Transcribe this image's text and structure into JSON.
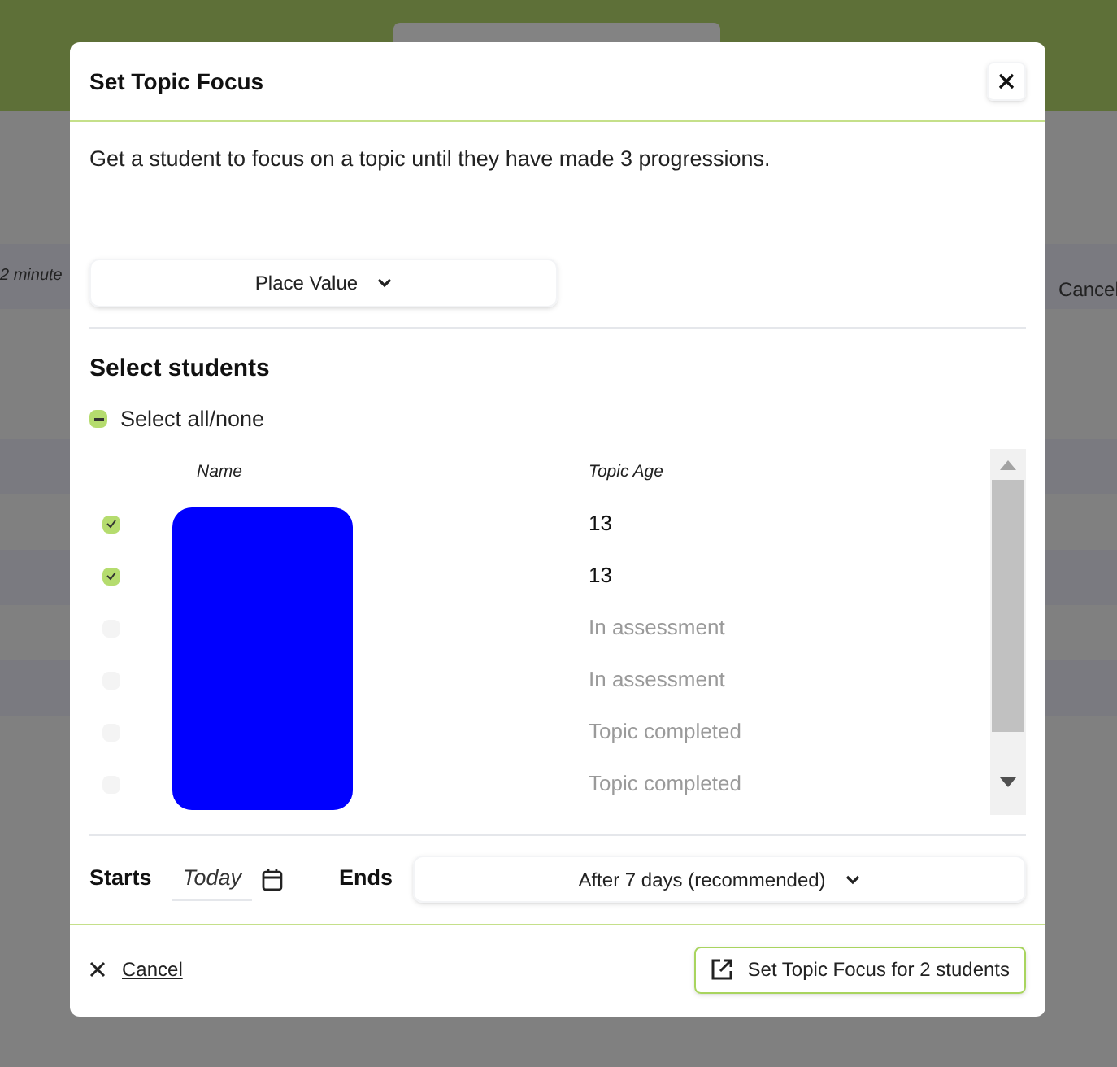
{
  "background_page": {
    "time_text": "2 minute",
    "cancel_text": "Cancel"
  },
  "dialog": {
    "title": "Set Topic Focus",
    "description": "Get a student to focus on a topic until they have made 3 progressions.",
    "topic_dropdown": "Place Value",
    "section_title": "Select students",
    "select_all": {
      "label": "Select all/none",
      "indeterminate": true
    },
    "table": {
      "columns": [
        "Name",
        "Topic Age"
      ],
      "names_redacted": true,
      "rows": [
        {
          "checked": true,
          "disabled": false,
          "topic_age": "13"
        },
        {
          "checked": true,
          "disabled": false,
          "topic_age": "13"
        },
        {
          "checked": false,
          "disabled": true,
          "topic_age": "In assessment"
        },
        {
          "checked": false,
          "disabled": true,
          "topic_age": "In assessment"
        },
        {
          "checked": false,
          "disabled": true,
          "topic_age": "Topic completed"
        },
        {
          "checked": false,
          "disabled": true,
          "topic_age": "Topic completed"
        }
      ]
    },
    "starts_label": "Starts",
    "starts_value": "Today",
    "ends_label": "Ends",
    "ends_dropdown": "After 7 days (recommended)",
    "cancel": "Cancel",
    "submit": "Set Topic Focus for 2 students"
  }
}
